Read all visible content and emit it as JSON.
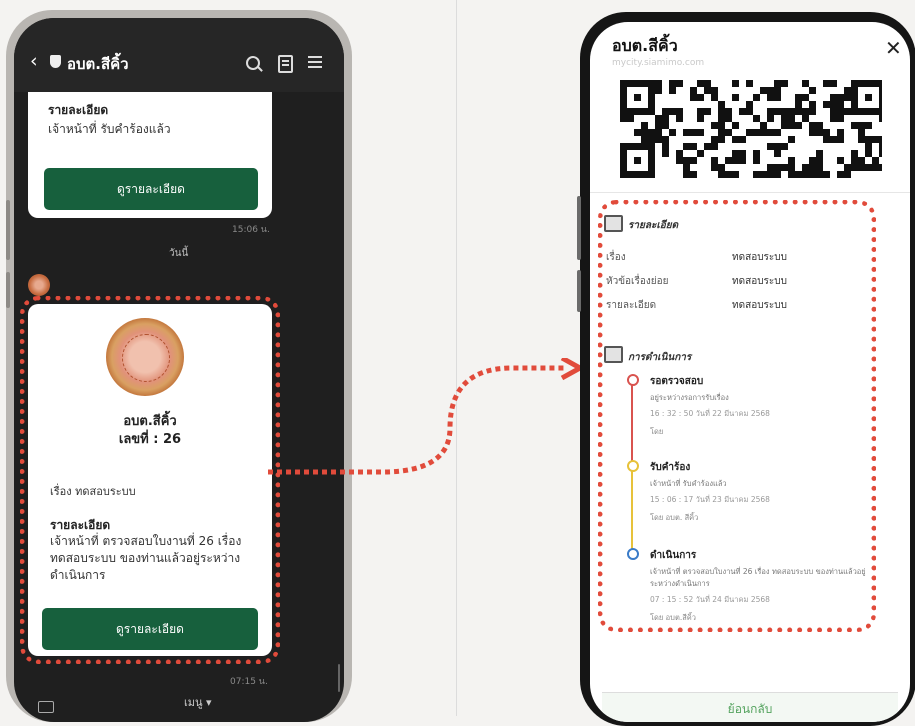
{
  "left_phone": {
    "header": {
      "title": "อบต.สีคิ้ว"
    },
    "card1": {
      "label": "รายละเอียด",
      "text": "เจ้าหน้าที่ รับคำร้องแล้ว",
      "button": "ดูรายละเอียด"
    },
    "time1": "15:06 น.",
    "day_label": "วันนี้",
    "card2": {
      "org": "อบต.สีคิ้ว",
      "number": "เลขที่ : 26",
      "subject": "เรื่อง ทดสอบระบบ",
      "detail_label": "รายละเอียด",
      "detail_text": "เจ้าหน้าที่ ตรวจสอบใบงานที่ 26 เรื่อง ทดสอบระบบ ของท่านแล้วอยู่ระหว่างดำเนินการ",
      "button": "ดูรายละเอียด"
    },
    "time2": "07:15 น.",
    "bottom_menu": "เมนู ▾"
  },
  "right_phone": {
    "title": "อบต.สีคิ้ว",
    "url": "mycity.siamimo.com",
    "close": "✕",
    "details_section": {
      "heading": "รายละเอียด",
      "rows": [
        {
          "key": "เรื่อง",
          "value": "ทดสอบระบบ"
        },
        {
          "key": "หัวข้อเรื่องย่อย",
          "value": "ทดสอบระบบ"
        },
        {
          "key": "รายละเอียด",
          "value": "ทดสอบระบบ"
        }
      ]
    },
    "process_section": {
      "heading": "การดำเนินการ",
      "steps": [
        {
          "title": "รอตรวจสอบ",
          "sub": "อยู่ระหว่างรอการรับเรื่อง",
          "date": "16 : 32 : 50 วันที่ 22 มีนาคม 2568",
          "by": "โดย",
          "color": "#d9534f"
        },
        {
          "title": "รับคำร้อง",
          "sub": "เจ้าหน้าที่ รับคำร้องแล้ว",
          "date": "15 : 06 : 17 วันที่ 23 มีนาคม 2568",
          "by": "โดย อบต. สีคิ้ว",
          "color": "#e7c23a"
        },
        {
          "title": "ดำเนินการ",
          "sub": "เจ้าหน้าที่ ตรวจสอบใบงานที่ 26 เรื่อง ทดสอบระบบ ของท่านแล้วอยู่ระหว่างดำเนินการ",
          "date": "07 : 15 : 52 วันที่ 24 มีนาคม 2568",
          "by": "โดย อบต.สีคิ้ว",
          "color": "#3a7bc8"
        }
      ]
    },
    "back_button": "ย้อนกลับ"
  },
  "colors": {
    "highlight": "#e14b3b",
    "button_green": "#17603d",
    "chat_bg": "#1f1f1f"
  }
}
